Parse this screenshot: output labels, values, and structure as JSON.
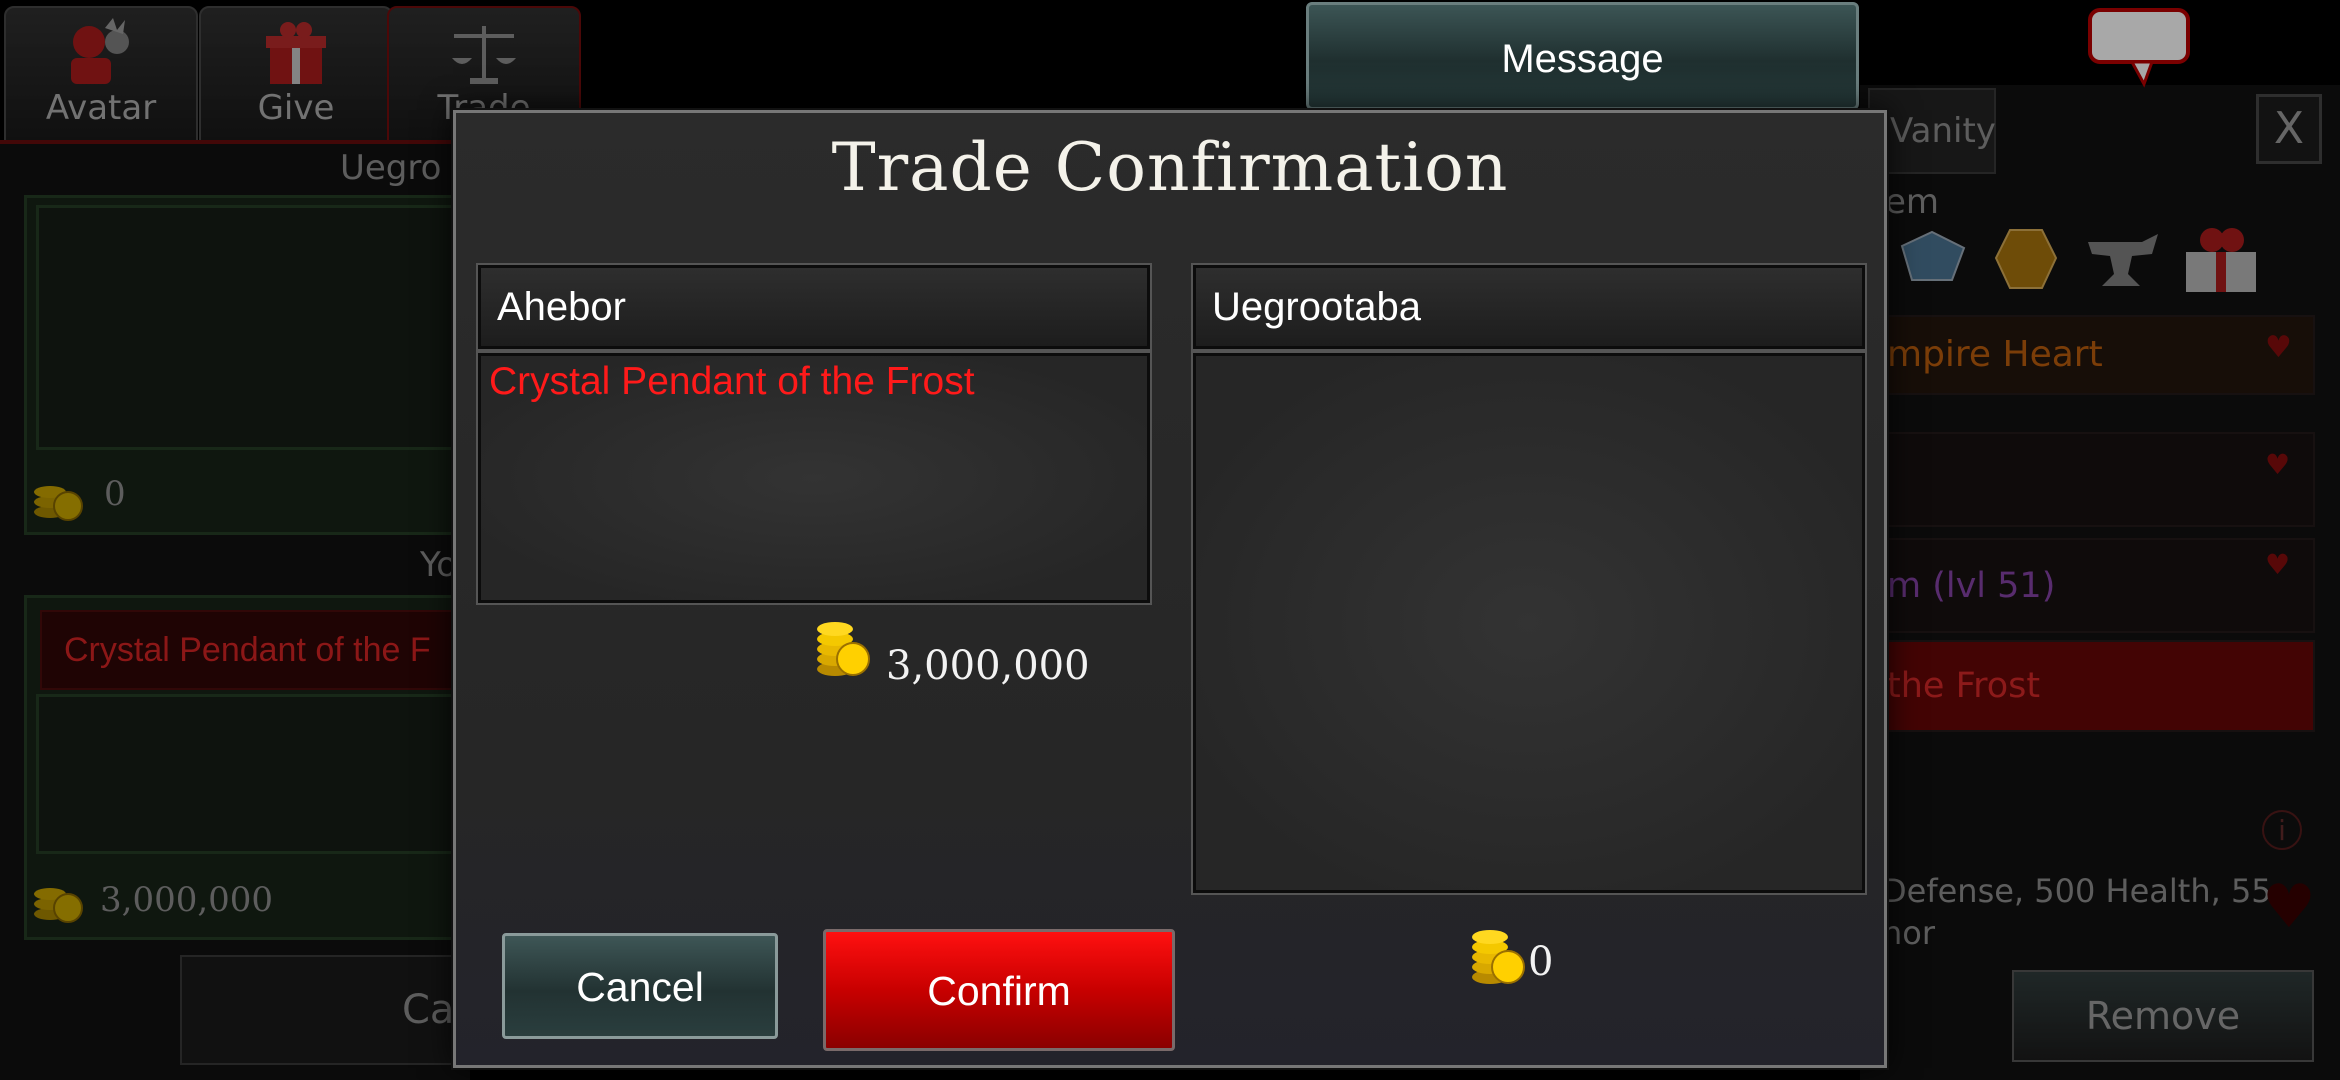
{
  "background": {
    "tabs": [
      {
        "label": "Avatar",
        "icon": "avatar-icon"
      },
      {
        "label": "Give",
        "icon": "gift-icon"
      },
      {
        "label": "Trade",
        "icon": "scales-icon"
      }
    ],
    "left_panel": {
      "partner_heading": "Uegro",
      "partner_gold": "0",
      "you_heading": "Yo",
      "your_item": "Crystal Pendant of the F",
      "your_gold": "3,000,000",
      "cancel_partial": "Ca"
    },
    "right_panel": {
      "vanity_tab": "Vanity",
      "close_label": "X",
      "item_heading": "em",
      "selected_item": "mpire Heart",
      "row_item_lvl": "m (lvl 51)",
      "row_item_frost": "the Frost",
      "stats_line1": "Defense, 500 Health, 55",
      "stats_line2": "nor",
      "remove_label": "Remove"
    },
    "message_button": "Message"
  },
  "modal": {
    "title": "Trade Confirmation",
    "left": {
      "player": "Ahebor",
      "items": [
        "Crystal Pendant of the Frost"
      ],
      "gold": "3,000,000"
    },
    "right": {
      "player": "Uegrootaba",
      "items": [],
      "gold": "0"
    },
    "cancel_label": "Cancel",
    "confirm_label": "Confirm"
  },
  "colors": {
    "item_rarity_red": "#ff1a1a",
    "confirm_red": "#d00000",
    "cancel_teal": "#2d4444"
  }
}
